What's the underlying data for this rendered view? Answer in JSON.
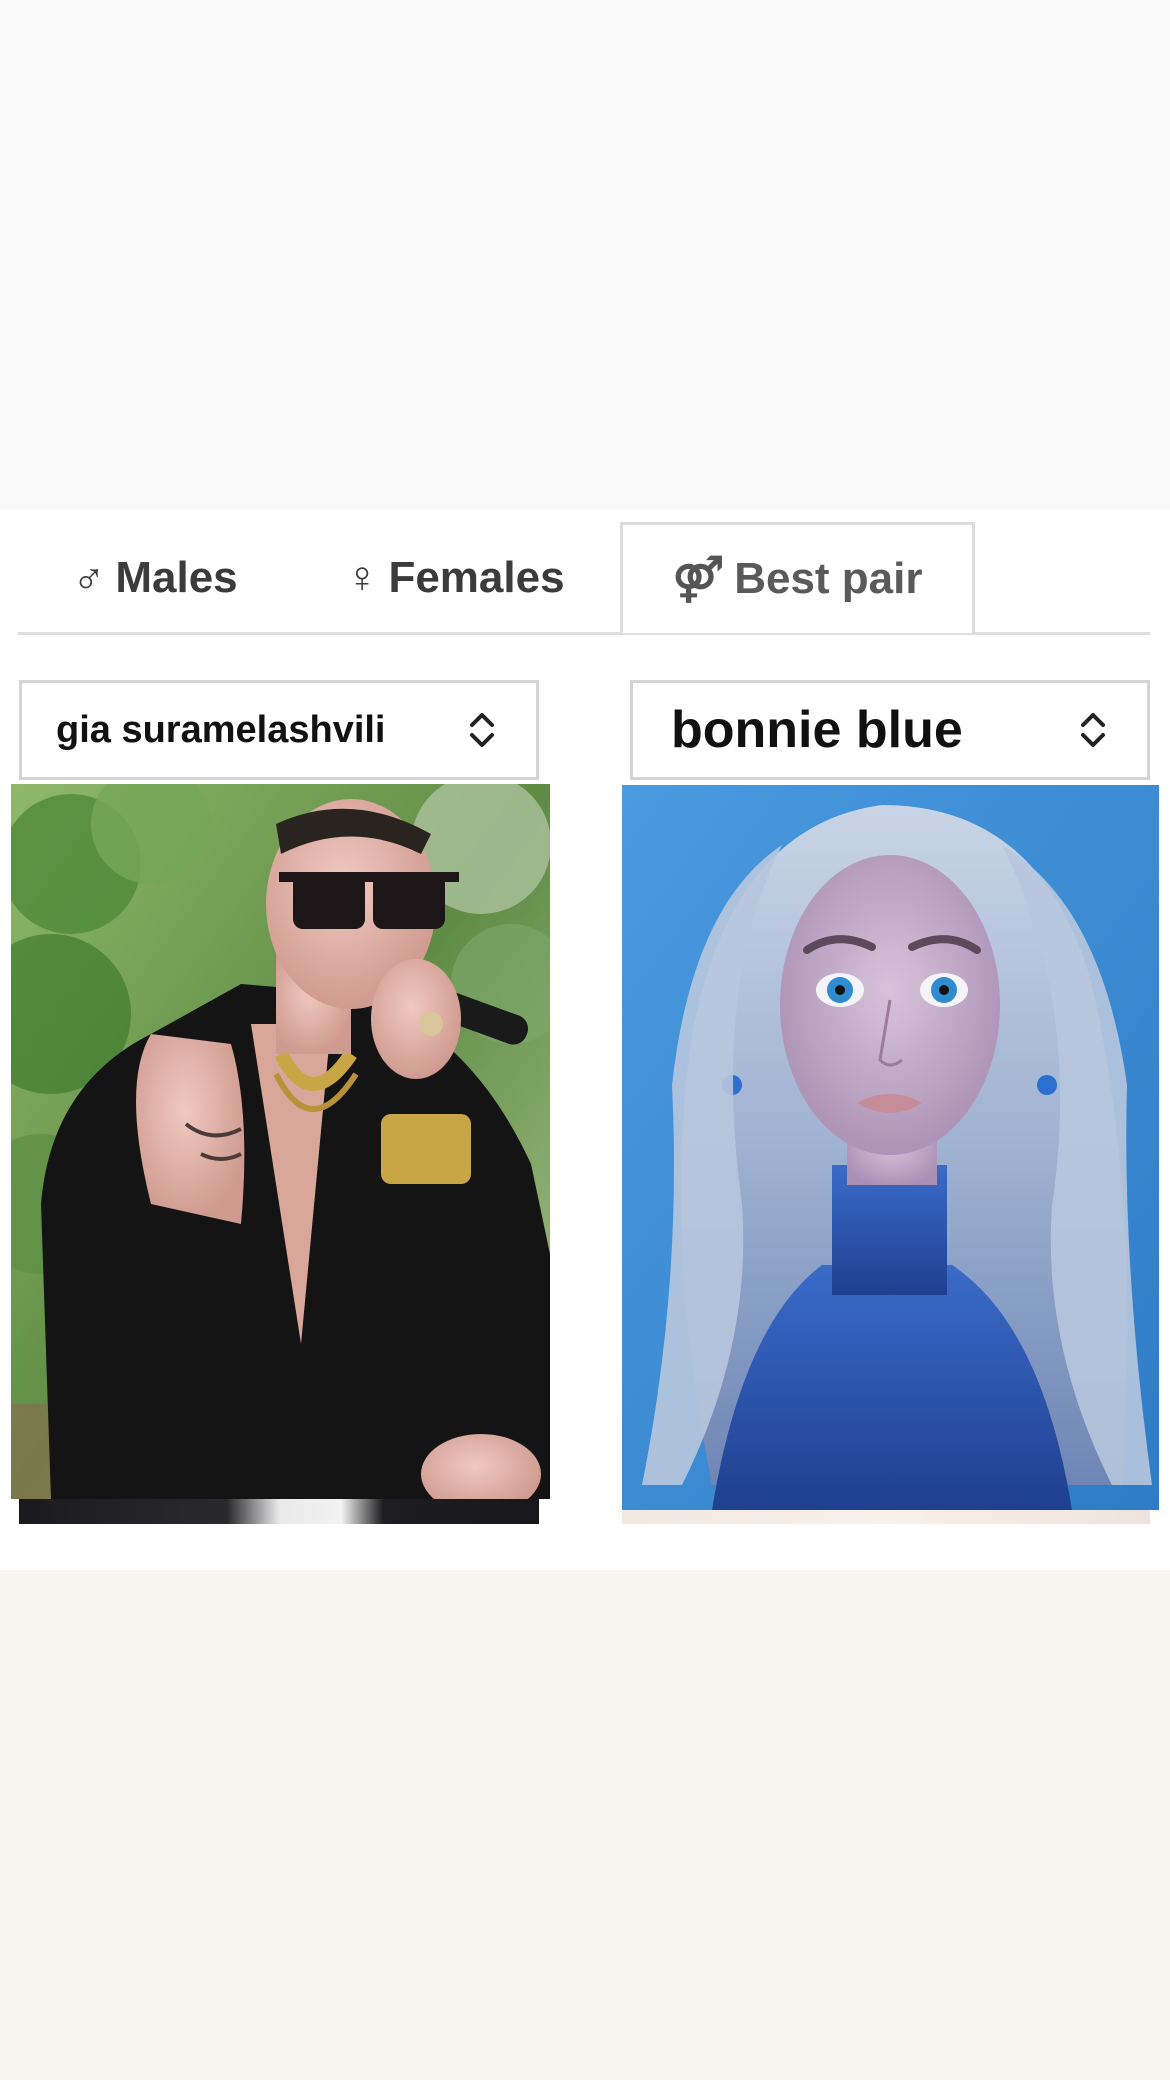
{
  "tabs": [
    {
      "label": "Males",
      "icon": "male-symbol-icon",
      "glyph": "♂",
      "active": false
    },
    {
      "label": "Females",
      "icon": "female-symbol-icon",
      "glyph": "♀",
      "active": false
    },
    {
      "label": "Best pair",
      "icon": "pair-symbol-icon",
      "glyph": "⚤",
      "active": true
    }
  ],
  "left_select": {
    "value": "gia suramelashvili"
  },
  "right_select": {
    "value": "bonnie blue"
  },
  "colors": {
    "tab_text": "#3b3b3b",
    "border": "#d4d4d4",
    "left_photo_background": "#6f9b52",
    "right_photo_background": "#3a8ad0"
  }
}
